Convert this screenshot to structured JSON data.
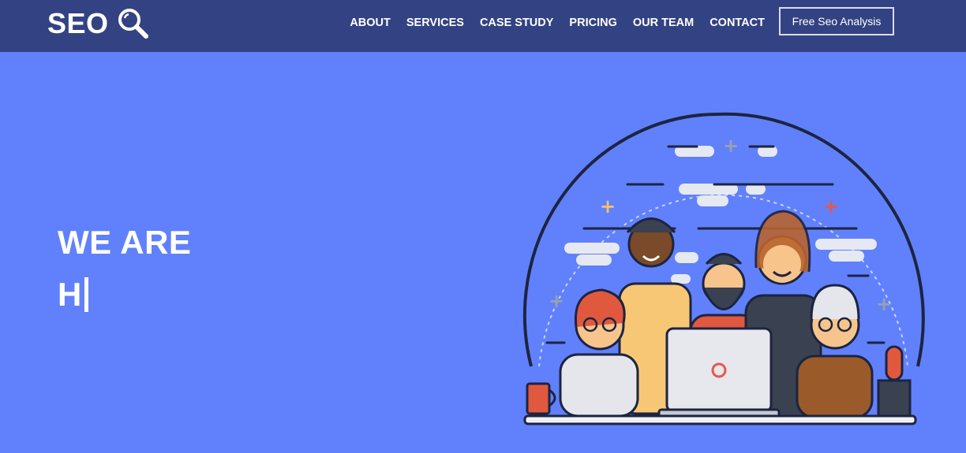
{
  "brand": {
    "name": "SEO",
    "icon": "magnifying-glass-icon"
  },
  "nav": {
    "items": [
      {
        "label": "ABOUT"
      },
      {
        "label": "SERVICES"
      },
      {
        "label": "CASE STUDY"
      },
      {
        "label": "PRICING"
      },
      {
        "label": "OUR TEAM"
      },
      {
        "label": "CONTACT"
      }
    ],
    "cta_label": "Free Seo Analysis"
  },
  "hero": {
    "line1": "WE ARE",
    "typed": "H"
  },
  "colors": {
    "navbar": "#334282",
    "hero_bg": "#6081fb",
    "text": "#ffffff"
  }
}
